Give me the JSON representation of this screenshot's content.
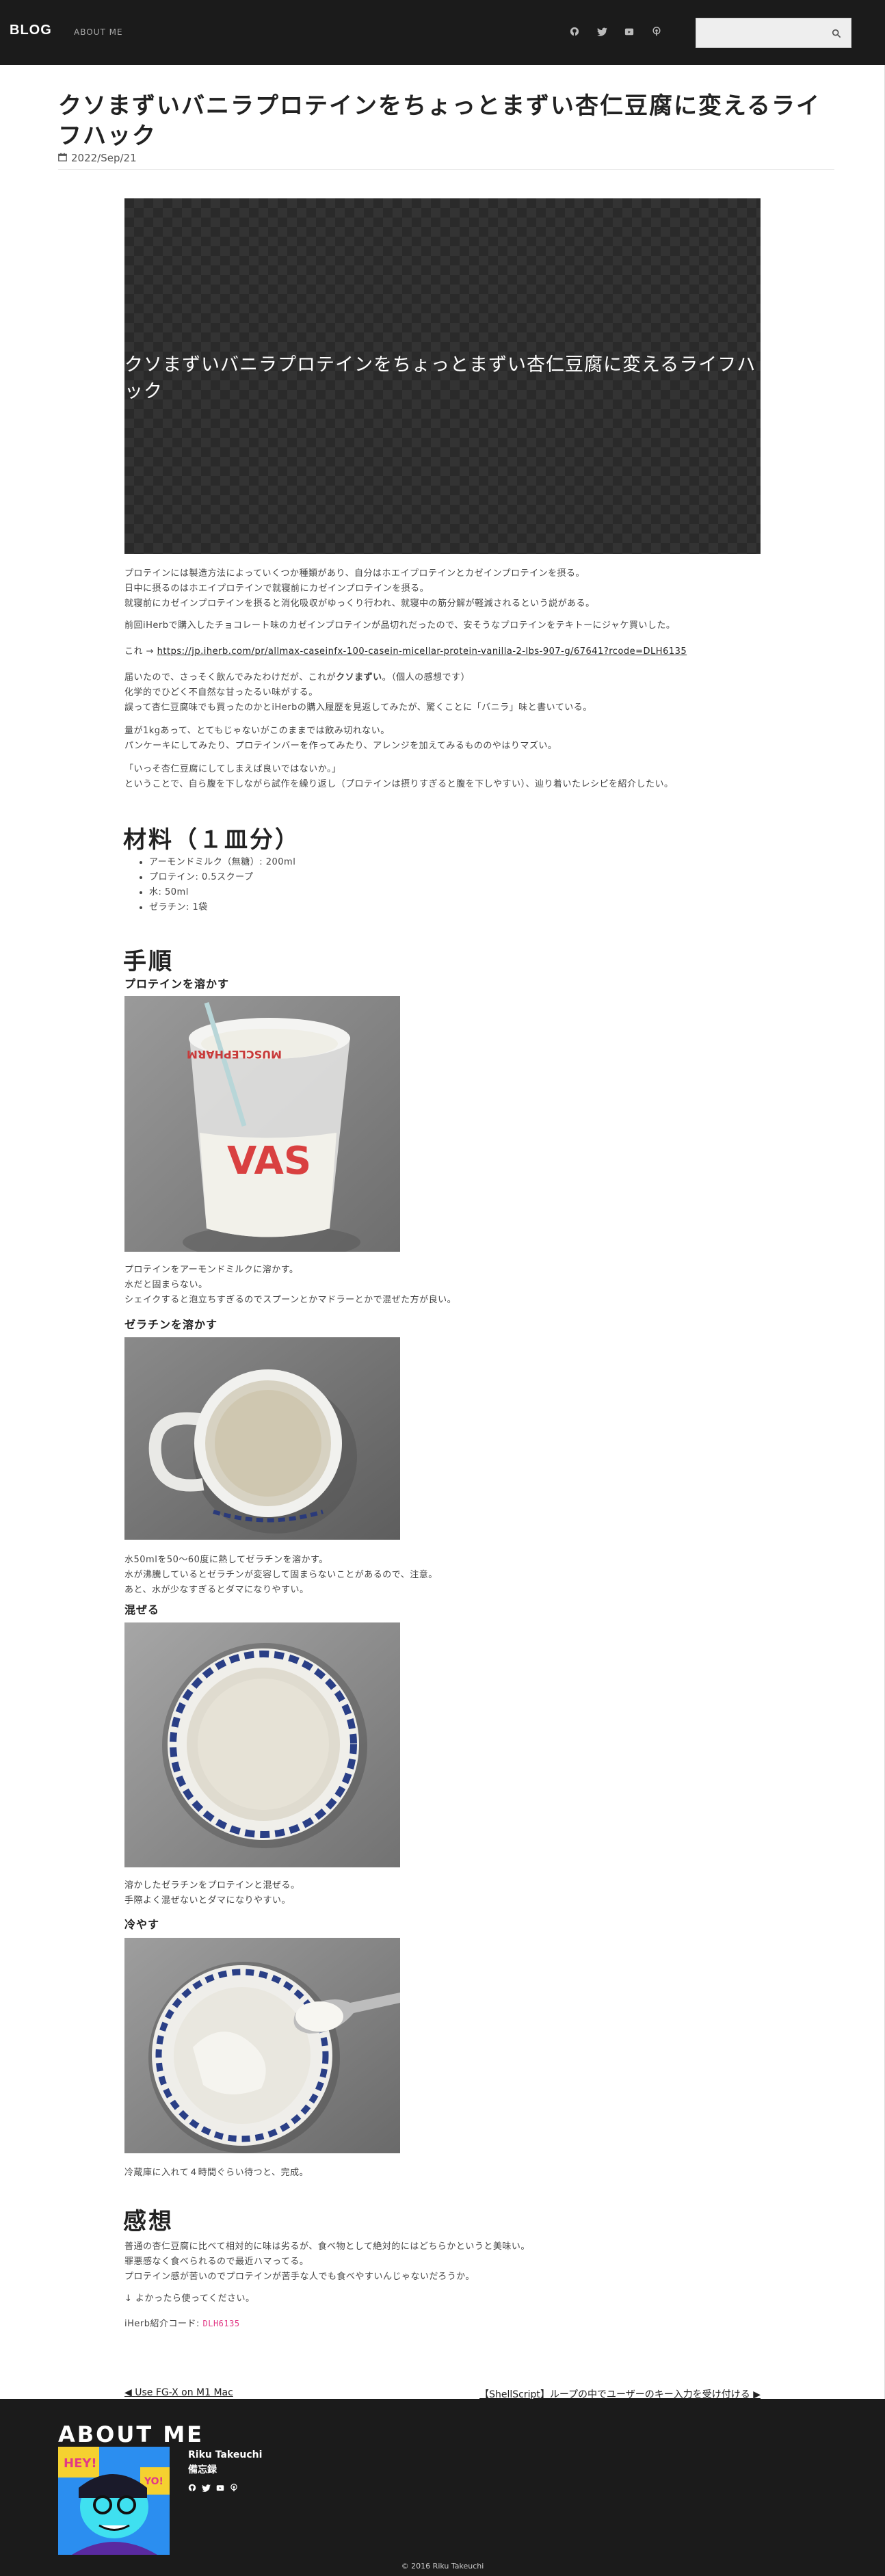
{
  "nav": {
    "brand": "BLOG",
    "about_label": "ABOUT ME",
    "icons": [
      "github-icon",
      "twitter-icon",
      "youtube-icon",
      "podcast-icon"
    ],
    "search_placeholder": ""
  },
  "post": {
    "title_line1": "クソまずいバニラプロテインをちょっとまずい杏仁豆腐に変えるライ",
    "title_line2": "フハック",
    "date": "2022/Sep/21",
    "hero_text": "クソまずいバニラプロテインをちょっとまずい杏仁豆腐に変えるライフハック",
    "intro": [
      [
        "プロテインには製造方法によっていくつか種類があり、自分はホエイプロテインとカゼインプロテインを摂る。",
        "日中に摂るのはホエイプロテインで就寝前にカゼインプロテインを摂る。",
        "就寝前にカゼインプロテインを摂ると消化吸収がゆっくり行われ、就寝中の筋分解が軽減されるという説がある。"
      ],
      [
        "前回iHerbで購入したチョコレート味のカゼインプロテインが品切れだったので、安そうなプロテインをテキトーにジャケ買いした。"
      ]
    ],
    "product_link_prefix": "これ → ",
    "product_link": "https://jp.iherb.com/pr/allmax-caseinfx-100-casein-micellar-protein-vanilla-2-lbs-907-g/67641?rcode=DLH6135",
    "arrived": [
      "届いたので、さっそく飲んでみたわけだが、これが",
      "クソまずい",
      "。（個人の感想です）"
    ],
    "arrived_more": [
      "化学的でひどく不自然な甘ったるい味がする。",
      "誤って杏仁豆腐味でも買ったのかとiHerbの購入履歴を見返してみたが、驚くことに「バニラ」味と書いている。"
    ],
    "amount": [
      "量が1kgあって、とてもじゃないがこのままでは飲み切れない。",
      "パンケーキにしてみたり、プロテインバーを作ってみたり、アレンジを加えてみるもののやはりマズい。"
    ],
    "idea": [
      "「いっそ杏仁豆腐にしてしまえば良いではないか。」",
      "ということで、自ら腹を下しながら試作を繰り返し（プロテインは摂りすぎると腹を下しやすい）、辿り着いたレシピを紹介したい。"
    ]
  },
  "ingredients": {
    "heading": "材料（１皿分）",
    "items": [
      "アーモンドミルク（無糖）: 200ml",
      "プロテイン: 0.5スクープ",
      "水: 50ml",
      "ゼラチン: 1袋"
    ]
  },
  "steps": {
    "heading": "手順",
    "s1": {
      "title": "プロテインを溶かす",
      "text": [
        "プロテインをアーモンドミルクに溶かす。",
        "水だと固まらない。",
        "シェイクすると泡立ちすぎるのでスプーンとかマドラーとかで混ぜた方が良い。"
      ]
    },
    "s2": {
      "title": "ゼラチンを溶かす",
      "text": [
        "水50mlを50〜60度に熱してゼラチンを溶かす。",
        "水が沸騰しているとゼラチンが変容して固まらないことがあるので、注意。",
        "あと、水が少なすぎるとダマになりやすい。"
      ]
    },
    "s3": {
      "title": "混ぜる",
      "text": [
        "溶かしたゼラチンをプロテインと混ぜる。",
        "手際よく混ぜないとダマになりやすい。"
      ]
    },
    "s4": {
      "title": "冷やす",
      "text": [
        "冷蔵庫に入れて４時間ぐらい待つと、完成。"
      ]
    },
    "cup_text": "MUSCLEPHARM"
  },
  "impressions": {
    "heading": "感想",
    "text": [
      "普通の杏仁豆腐に比べて相対的に味は劣るが、食べ物として絶対的にはどちらかというと美味い。",
      "罪悪感なく食べられるので最近ハマってる。",
      "プロテイン感が苦いのでプロテインが苦手な人でも食べやすいんじゃないだろうか。"
    ],
    "try": "↓ よかったら使ってください。",
    "code_label": "iHerb紹介コード: ",
    "code": "DLH6135"
  },
  "pager": {
    "prev": "Use FG-X on M1 Mac",
    "next": "【ShellScript】ループの中でユーザーのキー入力を受け付ける"
  },
  "footer": {
    "about_heading": "ABOUT ME",
    "name": "Riku Takeuchi",
    "subtitle": "備忘録",
    "avatar_text": [
      "HEY!",
      "YO!"
    ],
    "copyright": "© 2016 Riku Takeuchi"
  }
}
